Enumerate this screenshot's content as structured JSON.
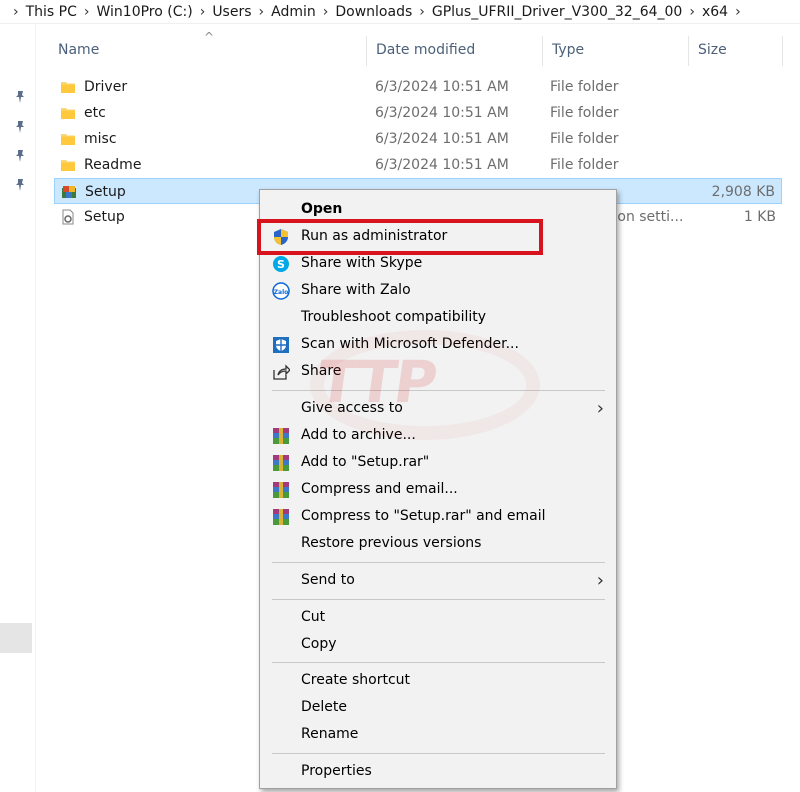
{
  "breadcrumb": {
    "items": [
      "This PC",
      "Win10Pro (C:)",
      "Users",
      "Admin",
      "Downloads",
      "GPlus_UFRII_Driver_V300_32_64_00",
      "x64"
    ]
  },
  "columns": {
    "name": "Name",
    "date": "Date modified",
    "type": "Type",
    "size": "Size"
  },
  "files": [
    {
      "name": "Driver",
      "date": "6/3/2024 10:51 AM",
      "type": "File folder",
      "size": "",
      "icon": "folder-icon"
    },
    {
      "name": "etc",
      "date": "6/3/2024 10:51 AM",
      "type": "File folder",
      "size": "",
      "icon": "folder-icon"
    },
    {
      "name": "misc",
      "date": "6/3/2024 10:51 AM",
      "type": "File folder",
      "size": "",
      "icon": "folder-icon"
    },
    {
      "name": "Readme",
      "date": "6/3/2024 10:51 AM",
      "type": "File folder",
      "size": "",
      "icon": "folder-icon"
    },
    {
      "name": "Setup",
      "date": "",
      "type": "",
      "size": "2,908 KB",
      "icon": "setup-exe-icon",
      "selected": true
    },
    {
      "name": "Setup",
      "date": "",
      "type": "tion setti...",
      "size": "1 KB",
      "icon": "settings-file-icon"
    }
  ],
  "context_menu": {
    "items": [
      {
        "label": "Open",
        "bold": true,
        "icon": ""
      },
      {
        "label": "Run as administrator",
        "icon": "uac-shield-icon"
      },
      {
        "label": "Share with Skype",
        "icon": "skype-icon"
      },
      {
        "label": "Share with Zalo",
        "icon": "zalo-icon"
      },
      {
        "label": "Troubleshoot compatibility",
        "icon": ""
      },
      {
        "label": "Scan with Microsoft Defender...",
        "icon": "defender-icon"
      },
      {
        "label": "Share",
        "icon": "share-icon"
      },
      {
        "label": "Give access to",
        "icon": "",
        "submenu": true
      },
      {
        "label": "Add to archive...",
        "icon": "winrar-icon"
      },
      {
        "label": "Add to \"Setup.rar\"",
        "icon": "winrar-icon"
      },
      {
        "label": "Compress and email...",
        "icon": "winrar-icon"
      },
      {
        "label": "Compress to \"Setup.rar\" and email",
        "icon": "winrar-icon"
      },
      {
        "label": "Restore previous versions",
        "icon": ""
      },
      {
        "label": "Send to",
        "icon": "",
        "submenu": true
      },
      {
        "label": "Cut",
        "icon": ""
      },
      {
        "label": "Copy",
        "icon": ""
      },
      {
        "label": "Create shortcut",
        "icon": ""
      },
      {
        "label": "Delete",
        "icon": ""
      },
      {
        "label": "Rename",
        "icon": ""
      },
      {
        "label": "Properties",
        "icon": ""
      }
    ]
  },
  "watermark": {
    "text": "TTP"
  },
  "colors": {
    "selection": "#cce8ff",
    "highlight_box": "#d7141d",
    "menu_bg": "#f2f2f2",
    "folder": "#f8d775"
  }
}
